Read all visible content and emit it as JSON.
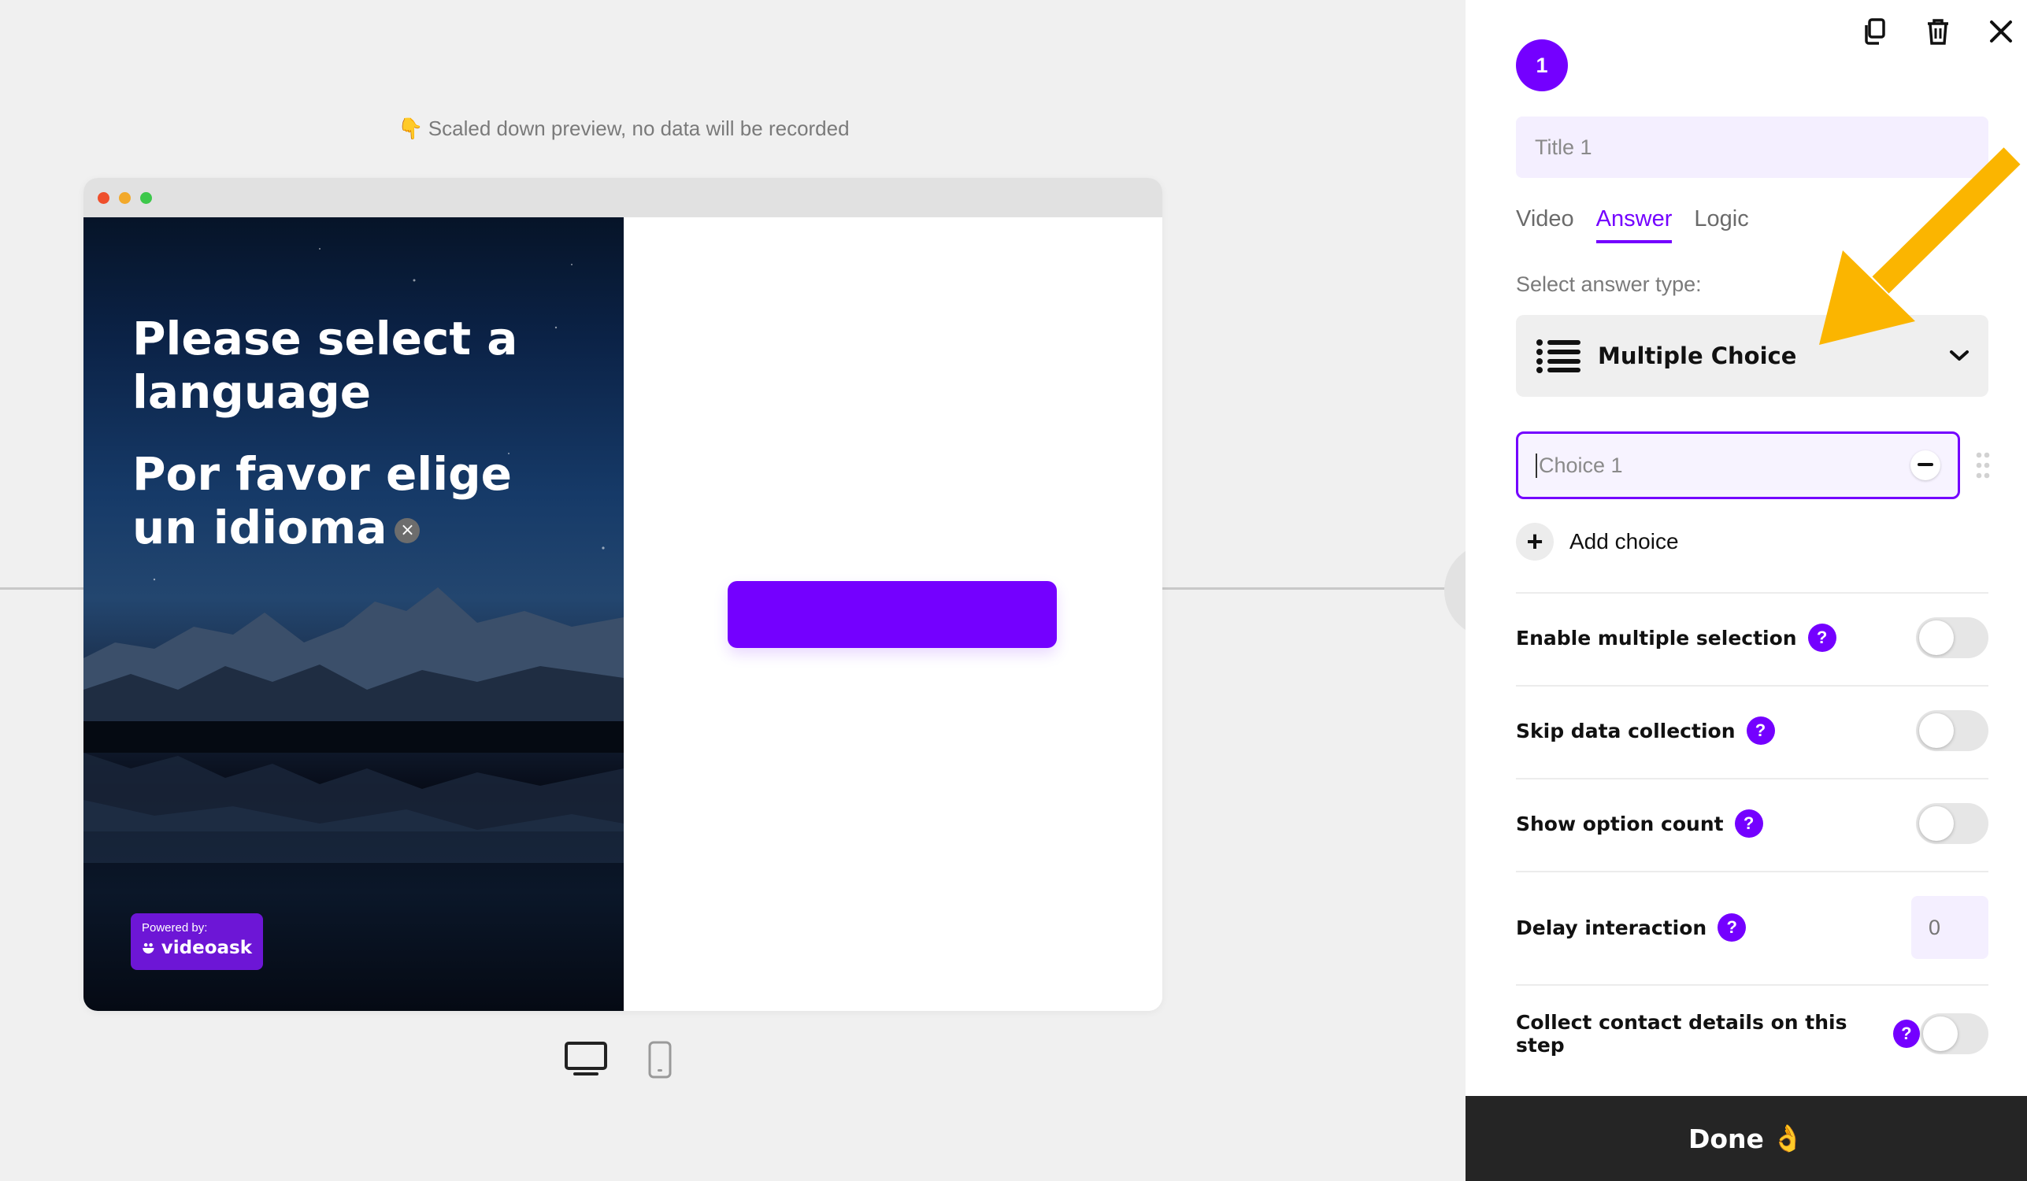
{
  "preview": {
    "hint_emoji": "👇",
    "hint_text": "Scaled down preview, no data will be recorded",
    "question_en": "Please select a language",
    "question_es": "Por favor elige un idioma",
    "close_glyph": "×",
    "powered_label": "Powered by:",
    "powered_brand": "videoask"
  },
  "panel": {
    "step_number": "1",
    "title_placeholder": "Title 1",
    "tabs": [
      {
        "label": "Video",
        "active": false
      },
      {
        "label": "Answer",
        "active": true
      },
      {
        "label": "Logic",
        "active": false
      }
    ],
    "answer_type_label": "Select answer type:",
    "answer_type_value": "Multiple Choice",
    "choice_placeholder": "Choice 1",
    "add_choice_label": "Add choice",
    "settings": {
      "enable_multiple": "Enable multiple selection",
      "skip_data": "Skip data collection",
      "show_count": "Show option count",
      "delay": "Delay interaction",
      "collect_contact": "Collect contact details on this step"
    },
    "help_glyph": "?",
    "delay_placeholder": "0",
    "done_label": "Done",
    "done_emoji": "👌"
  },
  "colors": {
    "accent": "#7400ff",
    "arrow": "#fbb500",
    "done_bg": "#252525"
  }
}
